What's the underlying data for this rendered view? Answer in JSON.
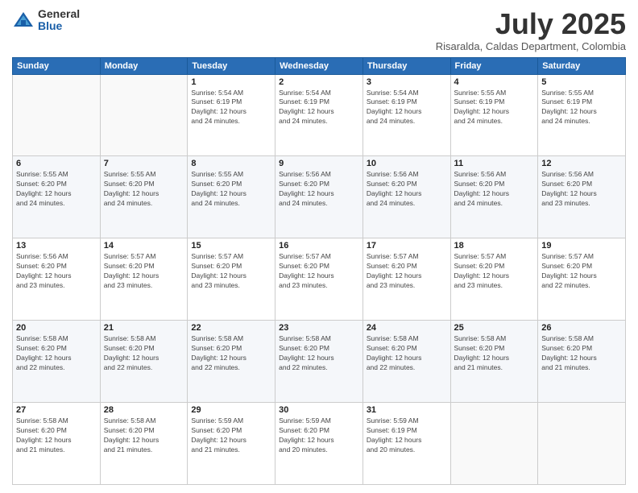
{
  "header": {
    "logo_general": "General",
    "logo_blue": "Blue",
    "month_title": "July 2025",
    "location": "Risaralda, Caldas Department, Colombia"
  },
  "weekdays": [
    "Sunday",
    "Monday",
    "Tuesday",
    "Wednesday",
    "Thursday",
    "Friday",
    "Saturday"
  ],
  "weeks": [
    [
      {
        "day": "",
        "info": ""
      },
      {
        "day": "",
        "info": ""
      },
      {
        "day": "1",
        "info": "Sunrise: 5:54 AM\nSunset: 6:19 PM\nDaylight: 12 hours\nand 24 minutes."
      },
      {
        "day": "2",
        "info": "Sunrise: 5:54 AM\nSunset: 6:19 PM\nDaylight: 12 hours\nand 24 minutes."
      },
      {
        "day": "3",
        "info": "Sunrise: 5:54 AM\nSunset: 6:19 PM\nDaylight: 12 hours\nand 24 minutes."
      },
      {
        "day": "4",
        "info": "Sunrise: 5:55 AM\nSunset: 6:19 PM\nDaylight: 12 hours\nand 24 minutes."
      },
      {
        "day": "5",
        "info": "Sunrise: 5:55 AM\nSunset: 6:19 PM\nDaylight: 12 hours\nand 24 minutes."
      }
    ],
    [
      {
        "day": "6",
        "info": "Sunrise: 5:55 AM\nSunset: 6:20 PM\nDaylight: 12 hours\nand 24 minutes."
      },
      {
        "day": "7",
        "info": "Sunrise: 5:55 AM\nSunset: 6:20 PM\nDaylight: 12 hours\nand 24 minutes."
      },
      {
        "day": "8",
        "info": "Sunrise: 5:55 AM\nSunset: 6:20 PM\nDaylight: 12 hours\nand 24 minutes."
      },
      {
        "day": "9",
        "info": "Sunrise: 5:56 AM\nSunset: 6:20 PM\nDaylight: 12 hours\nand 24 minutes."
      },
      {
        "day": "10",
        "info": "Sunrise: 5:56 AM\nSunset: 6:20 PM\nDaylight: 12 hours\nand 24 minutes."
      },
      {
        "day": "11",
        "info": "Sunrise: 5:56 AM\nSunset: 6:20 PM\nDaylight: 12 hours\nand 24 minutes."
      },
      {
        "day": "12",
        "info": "Sunrise: 5:56 AM\nSunset: 6:20 PM\nDaylight: 12 hours\nand 23 minutes."
      }
    ],
    [
      {
        "day": "13",
        "info": "Sunrise: 5:56 AM\nSunset: 6:20 PM\nDaylight: 12 hours\nand 23 minutes."
      },
      {
        "day": "14",
        "info": "Sunrise: 5:57 AM\nSunset: 6:20 PM\nDaylight: 12 hours\nand 23 minutes."
      },
      {
        "day": "15",
        "info": "Sunrise: 5:57 AM\nSunset: 6:20 PM\nDaylight: 12 hours\nand 23 minutes."
      },
      {
        "day": "16",
        "info": "Sunrise: 5:57 AM\nSunset: 6:20 PM\nDaylight: 12 hours\nand 23 minutes."
      },
      {
        "day": "17",
        "info": "Sunrise: 5:57 AM\nSunset: 6:20 PM\nDaylight: 12 hours\nand 23 minutes."
      },
      {
        "day": "18",
        "info": "Sunrise: 5:57 AM\nSunset: 6:20 PM\nDaylight: 12 hours\nand 23 minutes."
      },
      {
        "day": "19",
        "info": "Sunrise: 5:57 AM\nSunset: 6:20 PM\nDaylight: 12 hours\nand 22 minutes."
      }
    ],
    [
      {
        "day": "20",
        "info": "Sunrise: 5:58 AM\nSunset: 6:20 PM\nDaylight: 12 hours\nand 22 minutes."
      },
      {
        "day": "21",
        "info": "Sunrise: 5:58 AM\nSunset: 6:20 PM\nDaylight: 12 hours\nand 22 minutes."
      },
      {
        "day": "22",
        "info": "Sunrise: 5:58 AM\nSunset: 6:20 PM\nDaylight: 12 hours\nand 22 minutes."
      },
      {
        "day": "23",
        "info": "Sunrise: 5:58 AM\nSunset: 6:20 PM\nDaylight: 12 hours\nand 22 minutes."
      },
      {
        "day": "24",
        "info": "Sunrise: 5:58 AM\nSunset: 6:20 PM\nDaylight: 12 hours\nand 22 minutes."
      },
      {
        "day": "25",
        "info": "Sunrise: 5:58 AM\nSunset: 6:20 PM\nDaylight: 12 hours\nand 21 minutes."
      },
      {
        "day": "26",
        "info": "Sunrise: 5:58 AM\nSunset: 6:20 PM\nDaylight: 12 hours\nand 21 minutes."
      }
    ],
    [
      {
        "day": "27",
        "info": "Sunrise: 5:58 AM\nSunset: 6:20 PM\nDaylight: 12 hours\nand 21 minutes."
      },
      {
        "day": "28",
        "info": "Sunrise: 5:58 AM\nSunset: 6:20 PM\nDaylight: 12 hours\nand 21 minutes."
      },
      {
        "day": "29",
        "info": "Sunrise: 5:59 AM\nSunset: 6:20 PM\nDaylight: 12 hours\nand 21 minutes."
      },
      {
        "day": "30",
        "info": "Sunrise: 5:59 AM\nSunset: 6:20 PM\nDaylight: 12 hours\nand 20 minutes."
      },
      {
        "day": "31",
        "info": "Sunrise: 5:59 AM\nSunset: 6:19 PM\nDaylight: 12 hours\nand 20 minutes."
      },
      {
        "day": "",
        "info": ""
      },
      {
        "day": "",
        "info": ""
      }
    ]
  ]
}
